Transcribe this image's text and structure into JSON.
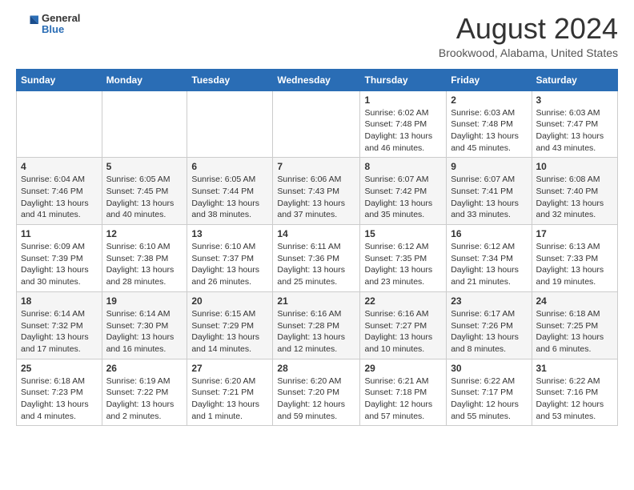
{
  "logo": {
    "general": "General",
    "blue": "Blue"
  },
  "title": "August 2024",
  "location": "Brookwood, Alabama, United States",
  "days_of_week": [
    "Sunday",
    "Monday",
    "Tuesday",
    "Wednesday",
    "Thursday",
    "Friday",
    "Saturday"
  ],
  "weeks": [
    [
      {
        "day": "",
        "info": ""
      },
      {
        "day": "",
        "info": ""
      },
      {
        "day": "",
        "info": ""
      },
      {
        "day": "",
        "info": ""
      },
      {
        "day": "1",
        "info": "Sunrise: 6:02 AM\nSunset: 7:48 PM\nDaylight: 13 hours\nand 46 minutes."
      },
      {
        "day": "2",
        "info": "Sunrise: 6:03 AM\nSunset: 7:48 PM\nDaylight: 13 hours\nand 45 minutes."
      },
      {
        "day": "3",
        "info": "Sunrise: 6:03 AM\nSunset: 7:47 PM\nDaylight: 13 hours\nand 43 minutes."
      }
    ],
    [
      {
        "day": "4",
        "info": "Sunrise: 6:04 AM\nSunset: 7:46 PM\nDaylight: 13 hours\nand 41 minutes."
      },
      {
        "day": "5",
        "info": "Sunrise: 6:05 AM\nSunset: 7:45 PM\nDaylight: 13 hours\nand 40 minutes."
      },
      {
        "day": "6",
        "info": "Sunrise: 6:05 AM\nSunset: 7:44 PM\nDaylight: 13 hours\nand 38 minutes."
      },
      {
        "day": "7",
        "info": "Sunrise: 6:06 AM\nSunset: 7:43 PM\nDaylight: 13 hours\nand 37 minutes."
      },
      {
        "day": "8",
        "info": "Sunrise: 6:07 AM\nSunset: 7:42 PM\nDaylight: 13 hours\nand 35 minutes."
      },
      {
        "day": "9",
        "info": "Sunrise: 6:07 AM\nSunset: 7:41 PM\nDaylight: 13 hours\nand 33 minutes."
      },
      {
        "day": "10",
        "info": "Sunrise: 6:08 AM\nSunset: 7:40 PM\nDaylight: 13 hours\nand 32 minutes."
      }
    ],
    [
      {
        "day": "11",
        "info": "Sunrise: 6:09 AM\nSunset: 7:39 PM\nDaylight: 13 hours\nand 30 minutes."
      },
      {
        "day": "12",
        "info": "Sunrise: 6:10 AM\nSunset: 7:38 PM\nDaylight: 13 hours\nand 28 minutes."
      },
      {
        "day": "13",
        "info": "Sunrise: 6:10 AM\nSunset: 7:37 PM\nDaylight: 13 hours\nand 26 minutes."
      },
      {
        "day": "14",
        "info": "Sunrise: 6:11 AM\nSunset: 7:36 PM\nDaylight: 13 hours\nand 25 minutes."
      },
      {
        "day": "15",
        "info": "Sunrise: 6:12 AM\nSunset: 7:35 PM\nDaylight: 13 hours\nand 23 minutes."
      },
      {
        "day": "16",
        "info": "Sunrise: 6:12 AM\nSunset: 7:34 PM\nDaylight: 13 hours\nand 21 minutes."
      },
      {
        "day": "17",
        "info": "Sunrise: 6:13 AM\nSunset: 7:33 PM\nDaylight: 13 hours\nand 19 minutes."
      }
    ],
    [
      {
        "day": "18",
        "info": "Sunrise: 6:14 AM\nSunset: 7:32 PM\nDaylight: 13 hours\nand 17 minutes."
      },
      {
        "day": "19",
        "info": "Sunrise: 6:14 AM\nSunset: 7:30 PM\nDaylight: 13 hours\nand 16 minutes."
      },
      {
        "day": "20",
        "info": "Sunrise: 6:15 AM\nSunset: 7:29 PM\nDaylight: 13 hours\nand 14 minutes."
      },
      {
        "day": "21",
        "info": "Sunrise: 6:16 AM\nSunset: 7:28 PM\nDaylight: 13 hours\nand 12 minutes."
      },
      {
        "day": "22",
        "info": "Sunrise: 6:16 AM\nSunset: 7:27 PM\nDaylight: 13 hours\nand 10 minutes."
      },
      {
        "day": "23",
        "info": "Sunrise: 6:17 AM\nSunset: 7:26 PM\nDaylight: 13 hours\nand 8 minutes."
      },
      {
        "day": "24",
        "info": "Sunrise: 6:18 AM\nSunset: 7:25 PM\nDaylight: 13 hours\nand 6 minutes."
      }
    ],
    [
      {
        "day": "25",
        "info": "Sunrise: 6:18 AM\nSunset: 7:23 PM\nDaylight: 13 hours\nand 4 minutes."
      },
      {
        "day": "26",
        "info": "Sunrise: 6:19 AM\nSunset: 7:22 PM\nDaylight: 13 hours\nand 2 minutes."
      },
      {
        "day": "27",
        "info": "Sunrise: 6:20 AM\nSunset: 7:21 PM\nDaylight: 13 hours\nand 1 minute."
      },
      {
        "day": "28",
        "info": "Sunrise: 6:20 AM\nSunset: 7:20 PM\nDaylight: 12 hours\nand 59 minutes."
      },
      {
        "day": "29",
        "info": "Sunrise: 6:21 AM\nSunset: 7:18 PM\nDaylight: 12 hours\nand 57 minutes."
      },
      {
        "day": "30",
        "info": "Sunrise: 6:22 AM\nSunset: 7:17 PM\nDaylight: 12 hours\nand 55 minutes."
      },
      {
        "day": "31",
        "info": "Sunrise: 6:22 AM\nSunset: 7:16 PM\nDaylight: 12 hours\nand 53 minutes."
      }
    ]
  ]
}
